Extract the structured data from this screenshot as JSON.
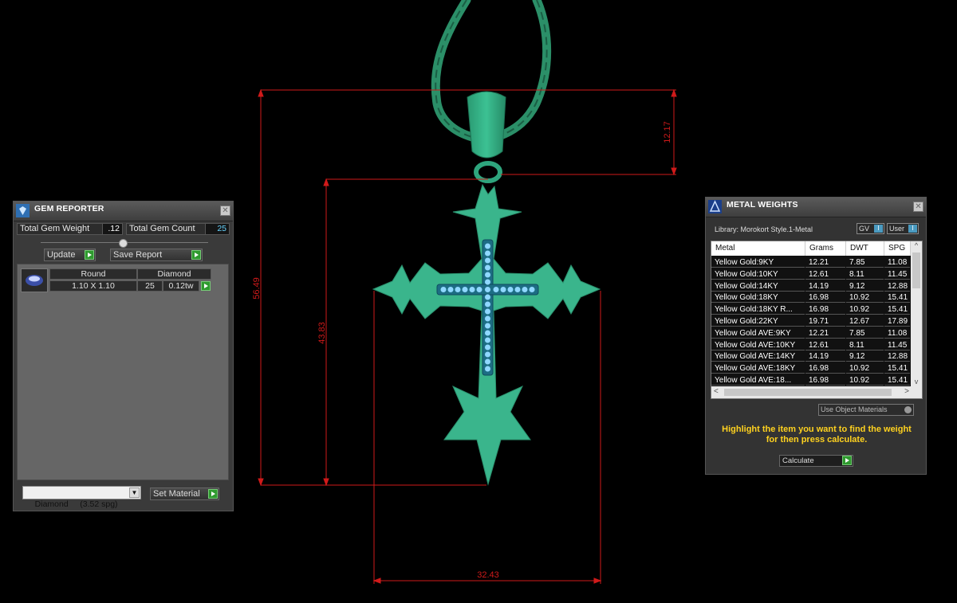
{
  "gem_reporter": {
    "title": "GEM REPORTER",
    "total_weight_label": "Total Gem Weight",
    "total_weight_value": ".12",
    "total_count_label": "Total Gem Count",
    "total_count_value": "25",
    "update_label": "Update",
    "save_report_label": "Save Report",
    "header_shape": "Round",
    "header_material": "Diamond",
    "row_size": "1.10 X 1.10",
    "row_count": "25",
    "row_weight": "0.12tw",
    "material_select": "Diamond     (3.52 spg)",
    "set_material_label": "Set Material"
  },
  "metal_weights": {
    "title": "METAL WEIGHTS",
    "library": "Library: Morokort Style.1-Metal",
    "gv_label": "GV",
    "user_label": "User",
    "columns": [
      "Metal",
      "Grams",
      "DWT",
      "SPG"
    ],
    "rows": [
      [
        "Yellow Gold:9KY",
        "12.21",
        "7.85",
        "11.08"
      ],
      [
        "Yellow Gold:10KY",
        "12.61",
        "8.11",
        "11.45"
      ],
      [
        "Yellow Gold:14KY",
        "14.19",
        "9.12",
        "12.88"
      ],
      [
        "Yellow Gold:18KY",
        "16.98",
        "10.92",
        "15.41"
      ],
      [
        "Yellow Gold:18KY R...",
        "16.98",
        "10.92",
        "15.41"
      ],
      [
        "Yellow Gold:22KY",
        "19.71",
        "12.67",
        "17.89"
      ],
      [
        "Yellow Gold AVE:9KY",
        "12.21",
        "7.85",
        "11.08"
      ],
      [
        "Yellow Gold AVE:10KY",
        "12.61",
        "8.11",
        "11.45"
      ],
      [
        "Yellow Gold AVE:14KY",
        "14.19",
        "9.12",
        "12.88"
      ],
      [
        "Yellow Gold AVE:18KY",
        "16.98",
        "10.92",
        "15.41"
      ],
      [
        "Yellow Gold AVE:18...",
        "16.98",
        "10.92",
        "15.41"
      ]
    ],
    "use_object_materials": "Use Object Materials",
    "hint": "Highlight the item you want to find the weight for then press calculate.",
    "calculate_label": "Calculate"
  },
  "dimensions": {
    "chain_height": "12.17",
    "total_height": "56.49",
    "cross_height": "43.83",
    "cross_width": "32.43"
  },
  "colors": {
    "background": "#000000",
    "model_green": "#3ab58c",
    "dimension_red": "#d01a1a",
    "gem_blue": "#8fd8ff",
    "hint_yellow": "#ffd21f",
    "value_cyan": "#66d4ff"
  },
  "icons": [
    "gem-reporter-icon",
    "metal-weights-icon",
    "close-icon",
    "play-icon",
    "dropdown-icon",
    "scroll-up-icon",
    "scroll-down-icon",
    "scroll-left-icon",
    "scroll-right-icon"
  ]
}
